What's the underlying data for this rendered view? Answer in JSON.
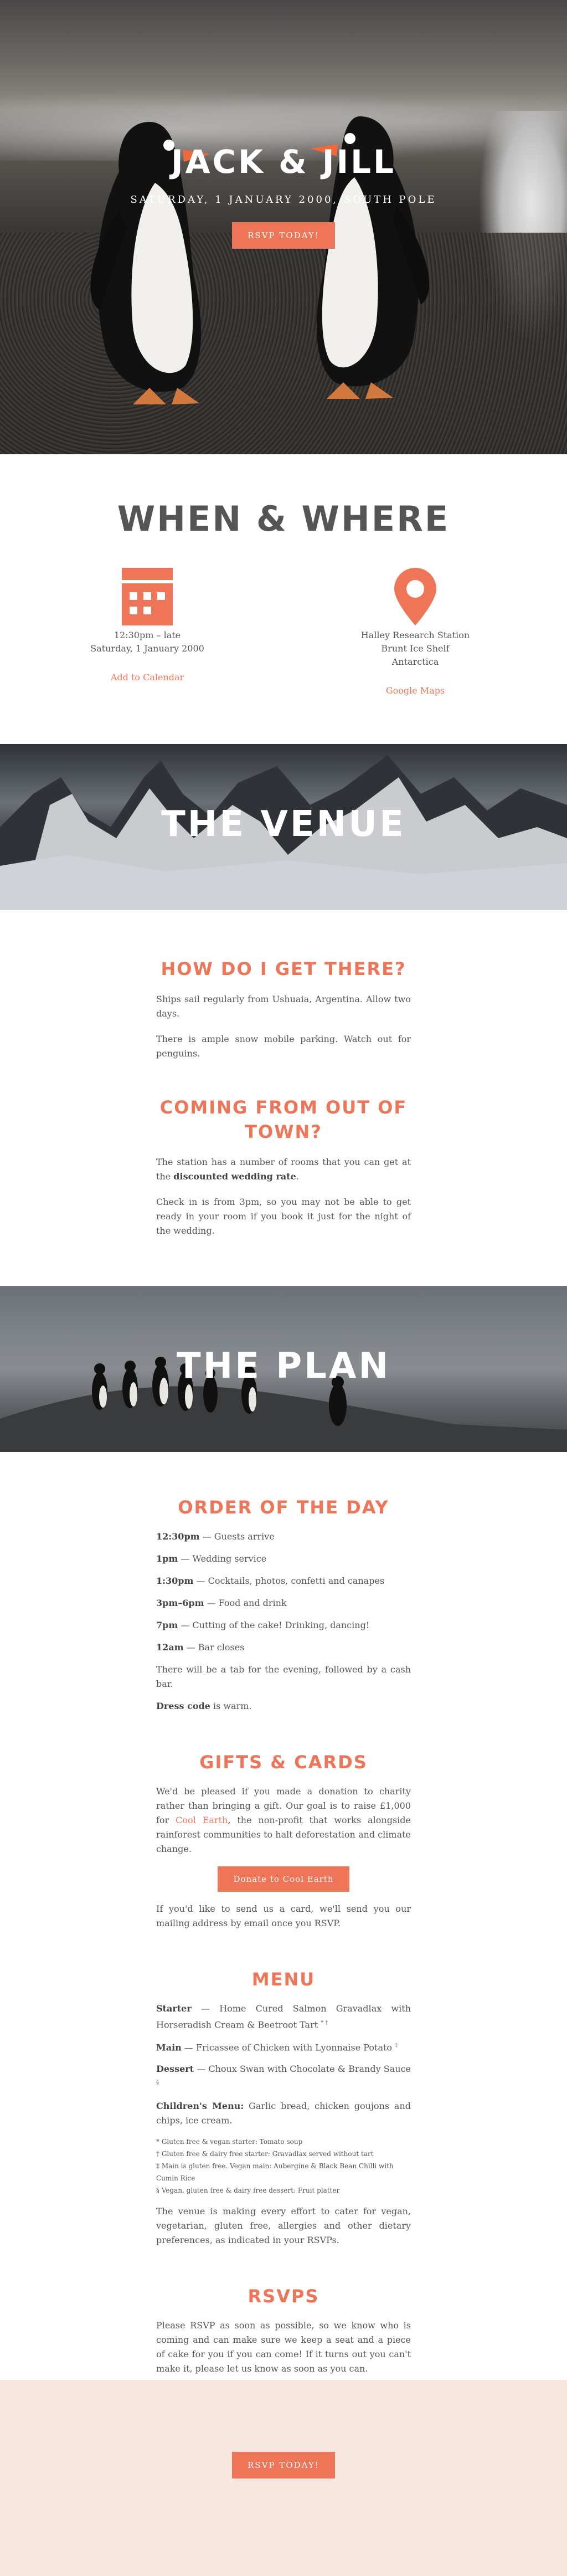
{
  "hero": {
    "title": "JACK & JILL",
    "subtitle": "SATURDAY, 1 JANUARY 2000, SOUTH POLE",
    "rsvp_button": "RSVP TODAY!"
  },
  "when_where": {
    "heading": "WHEN & WHERE",
    "when": {
      "icon": "calendar-icon",
      "line1": "12:30pm – late",
      "line2": "Saturday, 1 January 2000",
      "link": "Add to Calendar"
    },
    "where": {
      "icon": "map-pin-icon",
      "line1": "Halley Research Station",
      "line2": "Brunt Ice Shelf",
      "line3": "Antarctica",
      "link": "Google Maps"
    }
  },
  "venue": {
    "banner_title": "THE VENUE",
    "getting_there": {
      "heading": "HOW DO I GET THERE?",
      "p1": "Ships sail regularly from Ushuaia, Argentina. Allow two days.",
      "p2": "There is ample snow mobile parking. Watch out for penguins."
    },
    "out_of_town": {
      "heading_line1": "COMING FROM OUT OF",
      "heading_line2": "TOWN?",
      "p1_prefix": "The station has a number of rooms that you can get at the ",
      "p1_bold": "discounted wedding rate",
      "p1_suffix": ".",
      "p2": "Check in is from 3pm, so you may not be able to get ready in your room if you book it just for the night of the wedding."
    }
  },
  "plan": {
    "banner_title": "THE PLAN",
    "order": {
      "heading": "ORDER OF THE DAY",
      "items": [
        {
          "time": "12:30pm",
          "text": " — Guests arrive"
        },
        {
          "time": "1pm",
          "text": " — Wedding service"
        },
        {
          "time": "1:30pm",
          "text": " — Cocktails, photos, confetti and canapes"
        },
        {
          "time": "3pm–6pm",
          "text": " — Food and drink"
        },
        {
          "time": "7pm",
          "text": " — Cutting of the cake! Drinking, dancing!"
        },
        {
          "time": "12am",
          "text": " — Bar closes"
        }
      ],
      "tab_note": "There will be a tab for the evening, followed by a cash bar.",
      "dress_label": "Dress code",
      "dress_text": " is warm."
    },
    "gifts": {
      "heading": "GIFTS & CARDS",
      "p1_prefix": "We'd be pleased if you made a donation to charity rather than bringing a gift. Our goal is to raise £1,000 for ",
      "p1_link": "Cool Earth",
      "p1_suffix": ", the non-profit that works alongside rainforest communities to halt deforestation and climate change.",
      "donate_button": "Donate to Cool Earth",
      "p2": "If you'd like to send us a card, we'll send you our mailing address by email once you RSVP."
    },
    "menu": {
      "heading": "MENU",
      "starter_label": "Starter",
      "starter_text": " — Home Cured Salmon Gravadlax with Horseradish Cream & Beetroot Tart",
      "starter_marks": "* †",
      "main_label": "Main",
      "main_text": " — Fricassee of Chicken with Lyonnaise Potato",
      "main_mark": "‡",
      "dessert_label": "Dessert",
      "dessert_text": " — Choux Swan with Chocolate & Brandy Sauce",
      "dessert_mark": "§",
      "children_label": "Children's Menu:",
      "children_text": " Garlic bread, chicken goujons and chips, ice cream.",
      "footnotes": [
        "* Gluten free & vegan starter: Tomato soup",
        "† Gluten free & dairy free starter: Gravadlax served without tart",
        "‡ Main is gluten free. Vegan main: Aubergine & Black Bean Chilli with Cumin Rice",
        "§ Vegan, gluten free & dairy free dessert: Fruit platter"
      ],
      "catering_note": "The venue is making every effort to cater for vegan, vegetarian, gluten free, allergies and other dietary preferences, as indicated in your RSVPs."
    },
    "rsvps": {
      "heading": "RSVPS",
      "text": "Please RSVP as soon as possible, so we know who is coming and can make sure we keep a seat and a piece of cake for you if you can come! If it turns out you can't make it, please let us know as soon as you can."
    }
  },
  "footer": {
    "rsvp_button": "RSVP TODAY!"
  },
  "colors": {
    "accent": "#ee7558",
    "text": "#555555",
    "footer_bg": "#f9e7df"
  }
}
